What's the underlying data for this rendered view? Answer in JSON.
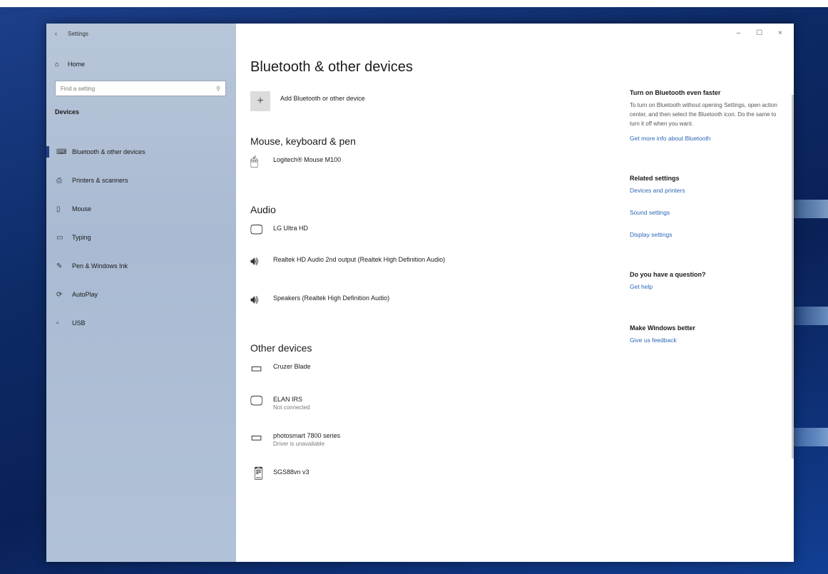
{
  "window": {
    "title": "Settings",
    "back_icon": "‹",
    "controls": [
      "–",
      "☐",
      "×"
    ]
  },
  "sidebar": {
    "home_label": "Home",
    "search_placeholder": "Find a setting",
    "category": "Devices",
    "items": [
      {
        "label": "Bluetooth & other devices",
        "icon": "bluetooth-devices-icon",
        "active": true
      },
      {
        "label": "Printers & scanners",
        "icon": "printer-icon"
      },
      {
        "label": "Mouse",
        "icon": "mouse-icon"
      },
      {
        "label": "Typing",
        "icon": "keyboard-icon"
      },
      {
        "label": "Pen & Windows Ink",
        "icon": "pen-icon"
      },
      {
        "label": "AutoPlay",
        "icon": "autoplay-icon"
      },
      {
        "label": "USB",
        "icon": "usb-icon"
      }
    ]
  },
  "main": {
    "title": "Bluetooth & other devices",
    "add_device_label": "Add Bluetooth or other device",
    "sections": {
      "mouse_keyboard_pen": {
        "heading": "Mouse, keyboard & pen",
        "devices": [
          {
            "name": "Logitech® Mouse M100",
            "icon": "mouse-icon"
          }
        ]
      },
      "audio": {
        "heading": "Audio",
        "devices": [
          {
            "name": "LG Ultra HD",
            "icon": "monitor-icon"
          },
          {
            "name": "Realtek HD Audio 2nd output (Realtek High Definition Audio)",
            "icon": "speaker-icon"
          },
          {
            "name": "Speakers (Realtek High Definition Audio)",
            "icon": "speaker-icon"
          }
        ]
      },
      "other": {
        "heading": "Other devices",
        "devices": [
          {
            "name": "Cruzer Blade",
            "icon": "usb-drive-icon"
          },
          {
            "name": "ELAN IRS",
            "status": "Not connected",
            "icon": "device-icon"
          },
          {
            "name": "photosmart 7800 series",
            "status": "Driver is unavailable",
            "icon": "printer-icon"
          },
          {
            "name": "SGS88vn v3",
            "icon": "phone-icon"
          }
        ]
      }
    }
  },
  "side_panel": {
    "faster": {
      "heading": "Turn on Bluetooth even faster",
      "text": "To turn on Bluetooth without opening Settings, open action center, and then select the Bluetooth icon. Do the same to turn it off when you want.",
      "link": "Get more info about Bluetooth"
    },
    "related": {
      "heading": "Related settings",
      "links": [
        "Devices and printers",
        "Sound settings",
        "Display settings"
      ]
    },
    "question": {
      "heading": "Do you have a question?",
      "link": "Get help"
    },
    "better": {
      "heading": "Make Windows better",
      "link": "Give us feedback"
    }
  }
}
